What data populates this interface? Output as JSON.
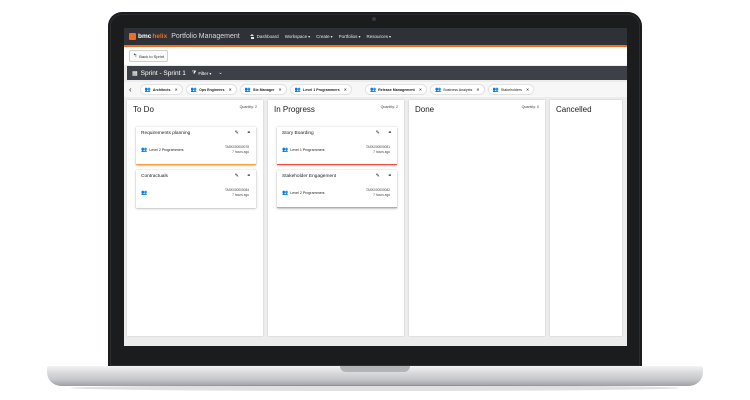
{
  "app": {
    "logo_bmc": "bmc",
    "logo_helix": "helix",
    "title": "Portfolio Management"
  },
  "nav": {
    "items": [
      {
        "label": "Dashboard"
      },
      {
        "label": "Workspace"
      },
      {
        "label": "Create"
      },
      {
        "label": "Portfolios"
      },
      {
        "label": "Resources"
      }
    ]
  },
  "back": {
    "label": "Back to Sprint"
  },
  "sprint": {
    "title": "Sprint - Sprint 1",
    "filter_label": "Filter"
  },
  "teams": [
    {
      "label": "Architects"
    },
    {
      "label": "Ops Engineers"
    },
    {
      "label": "Stx Manager"
    },
    {
      "label": "Level 1 Programmers"
    },
    {
      "label": "Release Management"
    },
    {
      "label": "Business Analysts"
    },
    {
      "label": "Stakeholders"
    }
  ],
  "columns": [
    {
      "title": "To Do",
      "quantity": "Quantity: 2",
      "cards": [
        {
          "title": "Requirements planning",
          "team": "Level 2 Programmers",
          "id": "TASK000000078",
          "time": "7 hours ago",
          "accent": "orange"
        },
        {
          "title": "Contractuals",
          "team": "",
          "id": "TASK000000084",
          "time": "7 hours ago",
          "accent": "none"
        }
      ]
    },
    {
      "title": "In Progress",
      "quantity": "Quantity: 2",
      "cards": [
        {
          "title": "Story Boarding",
          "team": "Level 1 Programmers",
          "id": "TASK000000081",
          "time": "7 hours ago",
          "accent": "red"
        },
        {
          "title": "Stakeholder Engagement",
          "team": "Level 2 Programmers",
          "id": "TASK000000082",
          "time": "7 hours ago",
          "accent": "orange"
        }
      ]
    },
    {
      "title": "Done",
      "quantity": "Quantity: 0",
      "cards": []
    },
    {
      "title": "Cancelled",
      "quantity": "",
      "cards": []
    }
  ],
  "icons": {
    "edit": "pencil-icon",
    "link": "link-icon",
    "team": "people-icon",
    "close": "close-icon"
  },
  "colors": {
    "brand_orange": "#f26b21",
    "topbar": "#2e3136",
    "card_orange": "#f5a03c",
    "card_red": "#e6503c"
  }
}
